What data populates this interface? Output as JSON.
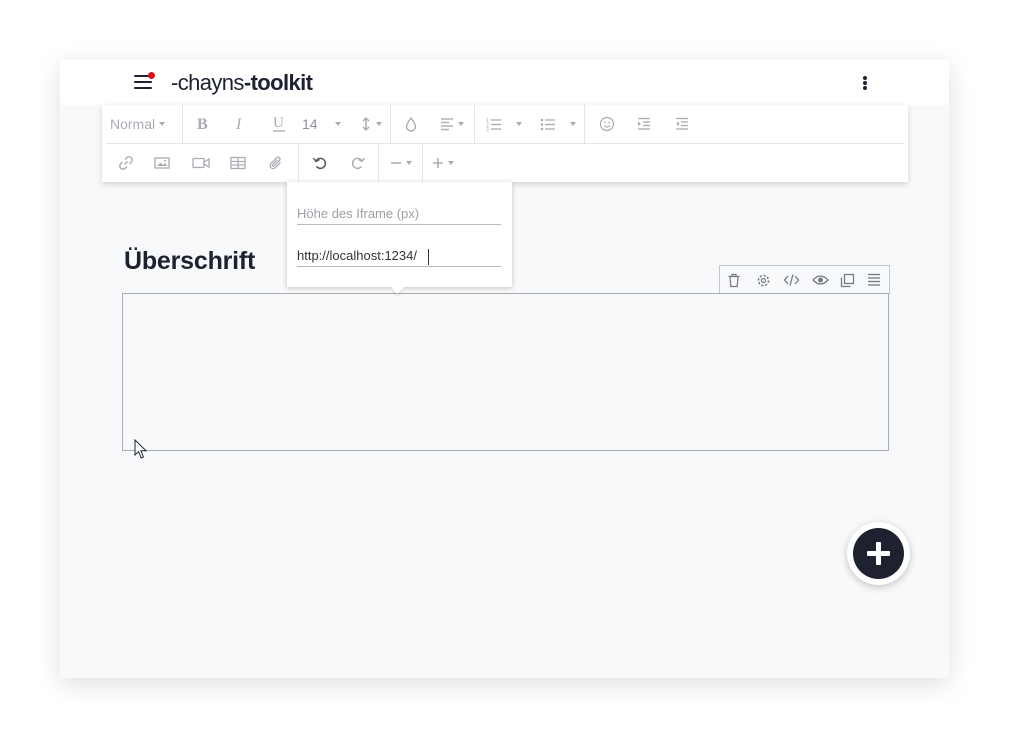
{
  "header": {
    "logo_brand": "-chayns",
    "logo_product": "-toolkit",
    "menu_icon": "hamburger-icon",
    "notification_color": "#e0101a",
    "more_icon": "kebab-menu-icon"
  },
  "toolbar": {
    "paragraph_style": "Normal",
    "font_size": "14",
    "row1_icons": [
      "bold-icon",
      "italic-icon",
      "underline-icon",
      "line-height-icon",
      "color-drop-icon",
      "align-left-icon",
      "ordered-list-icon",
      "bullet-list-icon",
      "emoji-icon",
      "indent-icon",
      "outdent-icon"
    ],
    "row2_icons": [
      "link-icon",
      "image-icon",
      "video-icon",
      "table-icon",
      "attachment-icon",
      "undo-icon",
      "redo-icon",
      "horizontal-rule-icon",
      "add-icon"
    ]
  },
  "iframe_popup": {
    "height_placeholder": "Höhe des Iframe (px)",
    "url_value": "http://localhost:1234/"
  },
  "content": {
    "heading": "Überschrift"
  },
  "iframe_toolbar": {
    "icons": [
      "trash-icon",
      "settings-icon",
      "code-icon",
      "eye-icon",
      "copy-icon",
      "align-justify-icon"
    ]
  },
  "colors": {
    "accent": "#1e2230",
    "background": "#f8f9fa",
    "toolbar_icon": "#a9acb3"
  }
}
